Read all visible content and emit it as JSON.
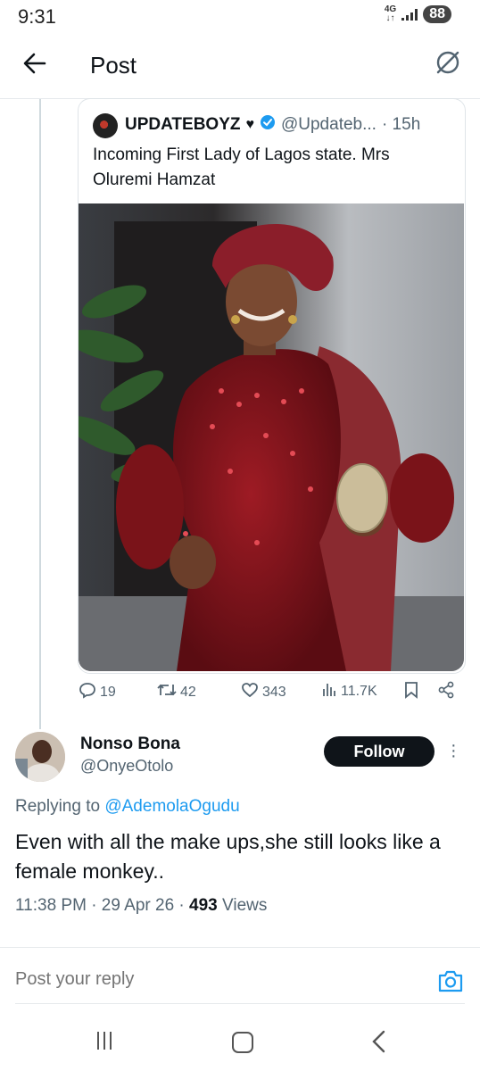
{
  "status_bar": {
    "time": "9:31",
    "network": "4G",
    "battery": "88"
  },
  "header": {
    "title": "Post"
  },
  "quoted": {
    "name": "UPDATEBOYZ",
    "handle": "@Updateb...",
    "time": "· 15h",
    "text": "Incoming First Lady of Lagos state. Mrs Oluremi Hamzat",
    "stats": {
      "replies": "19",
      "reposts": "42",
      "likes": "343",
      "views": "11.7K"
    }
  },
  "reply": {
    "name": "Nonso Bona",
    "handle": "@OnyeOtolo",
    "follow_label": "Follow",
    "replying_prefix": "Replying to",
    "replying_to": "@AdemolaOgudu",
    "text": "Even with all the make ups,she still looks like a female monkey..",
    "time": "11:38 PM · 29 Apr 26 ·",
    "views_count": "493",
    "views_label": "Views"
  },
  "composer": {
    "placeholder": "Post your reply"
  },
  "colors": {
    "accent": "#1d9bf0",
    "text": "#0f1419",
    "muted": "#536471",
    "button": "#0f1419"
  },
  "icons": [
    "back-arrow-icon",
    "grok-icon",
    "verified-icon",
    "reply-icon",
    "repost-icon",
    "like-icon",
    "views-icon",
    "bookmark-icon",
    "share-icon",
    "more-icon",
    "camera-icon"
  ]
}
